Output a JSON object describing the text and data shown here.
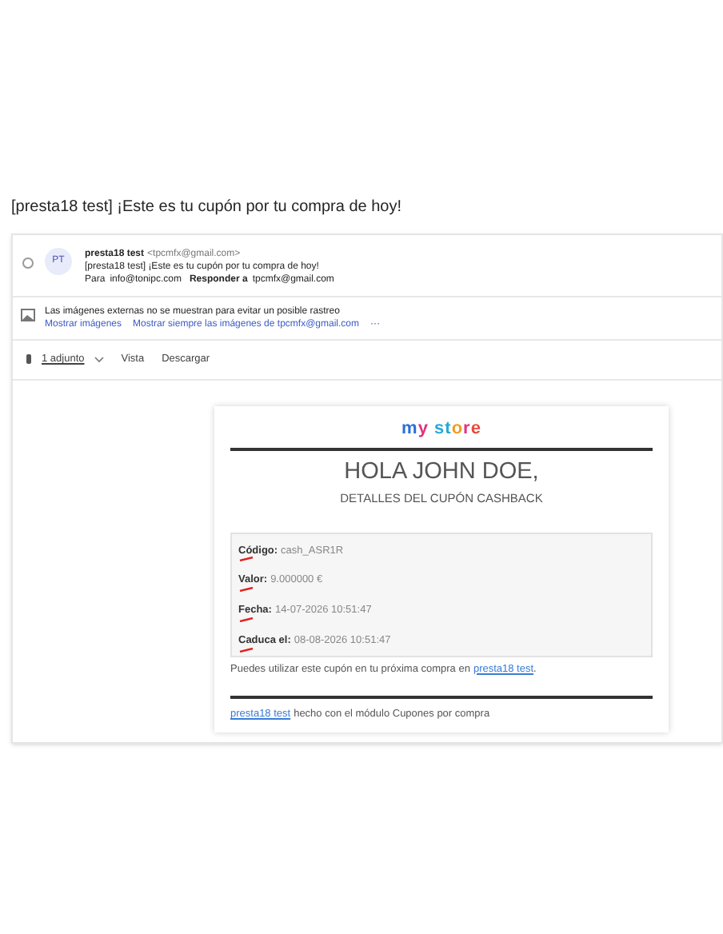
{
  "subject": "[presta18 test] ¡Este es tu cupón por tu compra de hoy!",
  "message": {
    "selected": false,
    "avatar": "PT",
    "sender_name": "presta18 test",
    "sender_email": "<tpcmfx@gmail.com>",
    "subject_line": "[presta18 test] ¡Este es tu cupón por tu compra de hoy!",
    "to_label": "Para",
    "to": "info@tonipc.com",
    "reply_label": "Responder a",
    "reply_to": "tpcmfx@gmail.com"
  },
  "images_notice": {
    "text": "Las imágenes externas no se muestran para evitar un posible rastreo",
    "show_link": "Mostrar imágenes",
    "always_link": "Mostrar siempre las imágenes de tpcmfx@gmail.com",
    "more": "···"
  },
  "attachments": {
    "label": "1 adjunto",
    "actions": [
      "Vista",
      "Descargar"
    ]
  },
  "email": {
    "logo": "my store",
    "greeting": "HOLA JOHN DOE,",
    "subtitle": "DETALLES DEL CUPÓN CASHBACK",
    "details": [
      {
        "label": "Código:",
        "value": "cash_ASR1R"
      },
      {
        "label": "Valor:",
        "value": "9.000000 €"
      },
      {
        "label": "Fecha:",
        "value": "14-07-2026 10:51:47"
      },
      {
        "label": "Caduca el:",
        "value": "08-08-2026 10:51:47"
      }
    ],
    "usage_text": "Puedes utilizar este cupón en tu próxima compra en",
    "usage_link": "presta18 test",
    "usage_end": ".",
    "footer_link": "presta18 test",
    "footer_text": "hecho con el módulo Cupones por compra"
  }
}
